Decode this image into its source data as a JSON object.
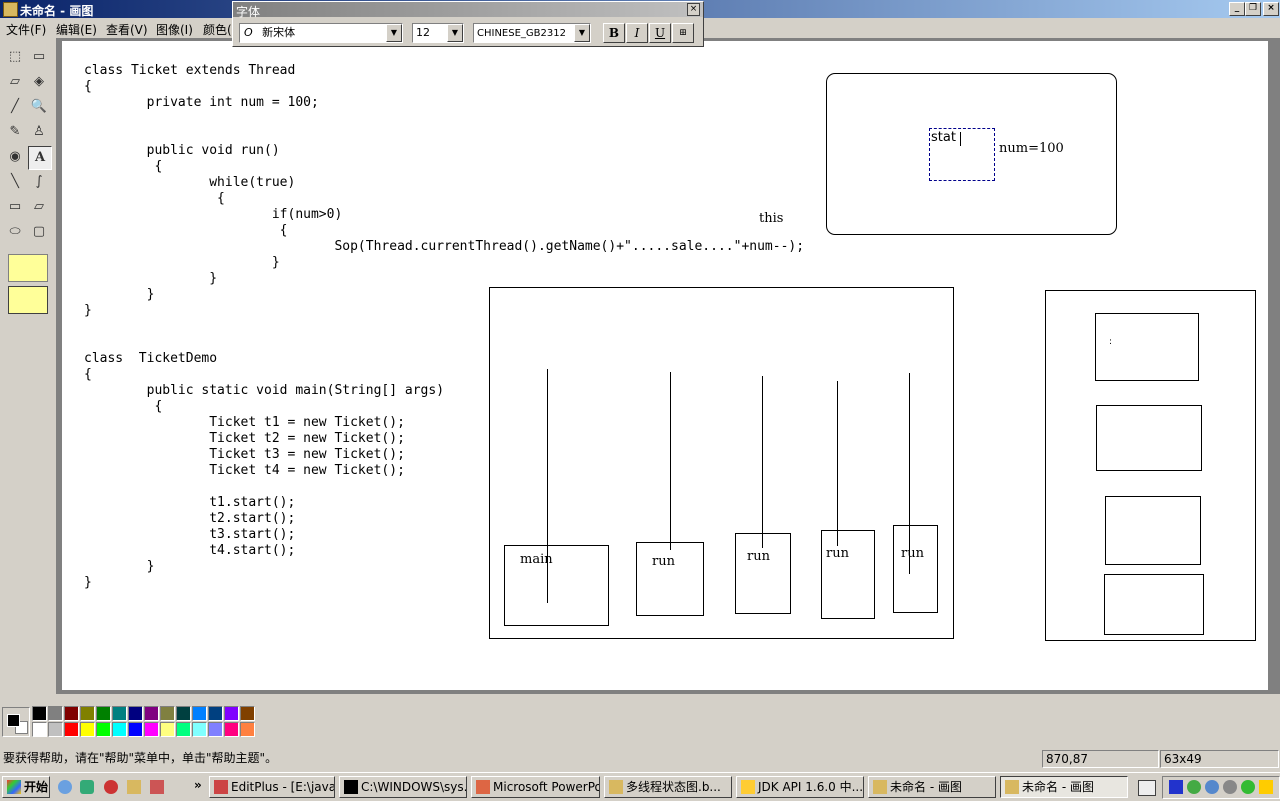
{
  "window": {
    "title": "未命名 - 画图"
  },
  "menu": [
    "文件(F)",
    "编辑(E)",
    "查看(V)",
    "图像(I)",
    "颜色("
  ],
  "font_toolbar": {
    "title": "字体",
    "font_name": "新宋体",
    "font_size": "12",
    "charset": "CHINESE_GB2312",
    "bold": "B",
    "italic": "I",
    "underline": "U"
  },
  "code_lines": [
    "class Ticket extends Thread",
    "{",
    "        private int num = 100;",
    "",
    "        public void run()",
    "         {",
    "                while(true)",
    "                 {",
    "                        if(num>0)",
    "                         {",
    "                                Sop(Thread.currentThread().getName()+\".....sale....\"+num--);",
    "                        }",
    "                }",
    "        }",
    "}",
    "",
    "class  TicketDemo",
    "{",
    "        public static void main(String[] args)",
    "         {",
    "                Ticket t1 = new Ticket();",
    "                Ticket t2 = new Ticket();",
    "                Ticket t3 = new Ticket();",
    "                Ticket t4 = new Ticket();",
    "",
    "                t1.start();",
    "                t2.start();",
    "                t3.start();",
    "                t4.start();",
    "        }",
    "}"
  ],
  "diagram": {
    "this_label": "this",
    "text_tool_value": "stat",
    "num_label": "num=100",
    "thread_labels": [
      "main",
      "run",
      "run",
      "run",
      "run"
    ],
    "small_mark": ":"
  },
  "status": {
    "help": "要获得帮助，请在\"帮助\"菜单中，单击\"帮助主题\"。",
    "coords": "870,87",
    "size": "63x49"
  },
  "taskbar": {
    "start": "开始",
    "tasks": [
      "EditPlus - [E:\\java...",
      "C:\\WINDOWS\\sys...",
      "Microsoft PowerPo...",
      "多线程状态图.b...",
      "JDK API 1.6.0 中...",
      "未命名 - 画图",
      "未命名 - 画图"
    ]
  },
  "colors": {
    "palette_row1": [
      "#000000",
      "#808080",
      "#800000",
      "#808000",
      "#008000",
      "#008080",
      "#000080",
      "#800080",
      "#808040",
      "#004040",
      "#0080ff",
      "#004080",
      "#8000ff",
      "#804000"
    ],
    "palette_row2": [
      "#ffffff",
      "#c0c0c0",
      "#ff0000",
      "#ffff00",
      "#00ff00",
      "#00ffff",
      "#0000ff",
      "#ff00ff",
      "#ffff80",
      "#00ff80",
      "#80ffff",
      "#8080ff",
      "#ff0080",
      "#ff8040"
    ]
  }
}
